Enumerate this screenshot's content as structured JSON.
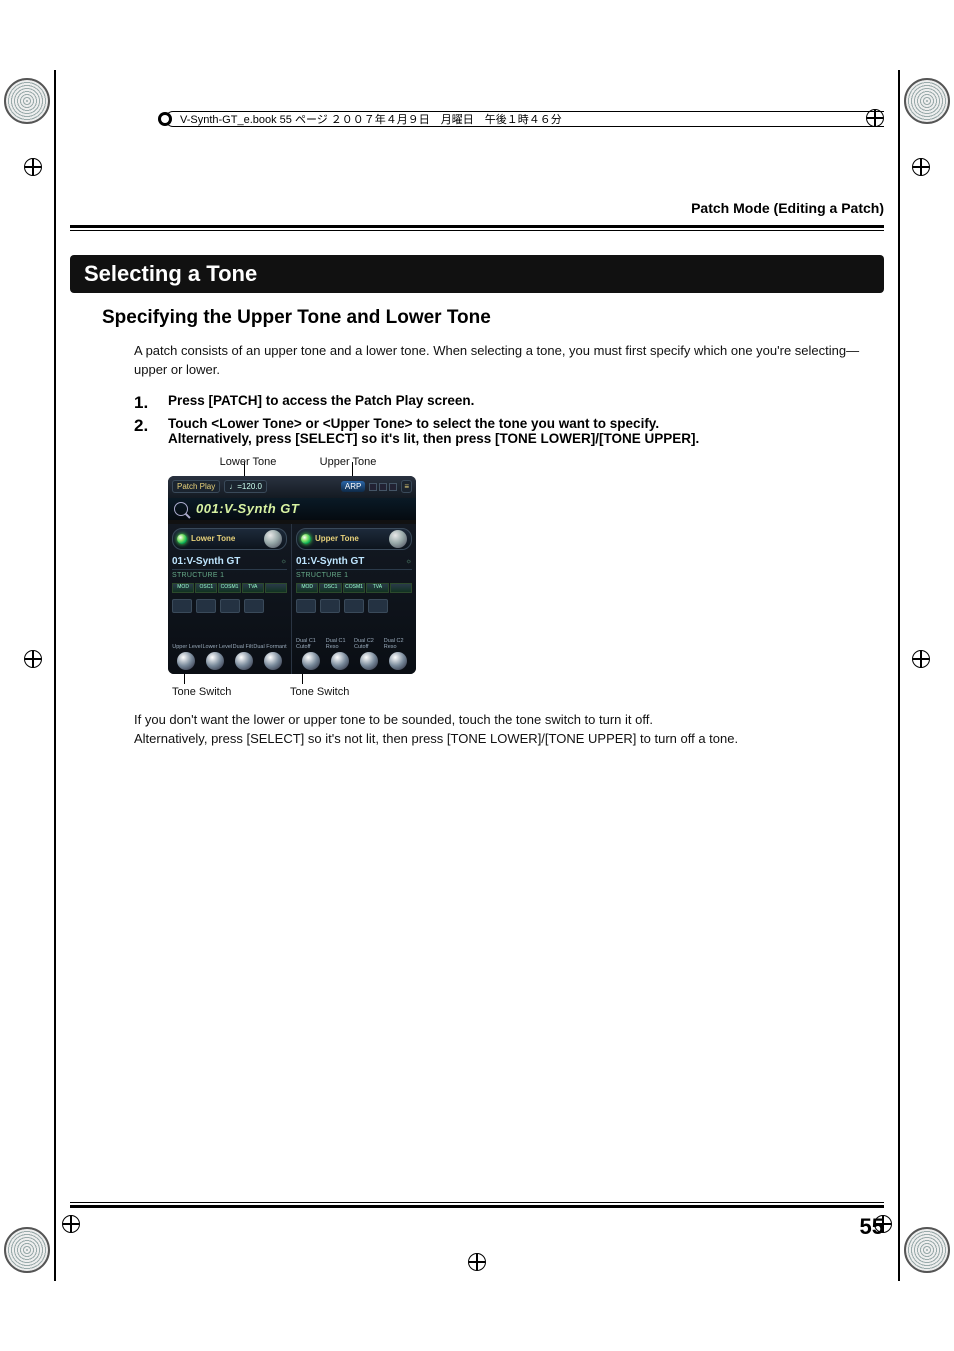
{
  "print": {
    "header_text": "V-Synth-GT_e.book 55 ページ ２００７年４月９日　月曜日　午後１時４６分"
  },
  "chapter_title": "Patch Mode (Editing a Patch)",
  "section_heading": "Selecting a Tone",
  "subsection_heading": "Specifying the Upper Tone and Lower Tone",
  "intro_paragraph": "A patch consists of an upper tone and a lower tone. When selecting a tone, you must first specify which one you're selecting—upper or lower.",
  "steps": [
    "Press [PATCH] to access the Patch Play screen.",
    "Touch <Lower Tone> or <Upper Tone> to select the tone you want to specify.\nAlternatively, press [SELECT] so it's lit, then press [TONE LOWER]/[TONE UPPER]."
  ],
  "figure": {
    "top_labels": {
      "lower": "Lower Tone",
      "upper": "Upper Tone"
    },
    "bottom_labels": {
      "left": "Tone Switch",
      "right": "Tone Switch"
    },
    "screen": {
      "nav_label": "Patch Play",
      "tempo": "120.0",
      "arp": "ARP",
      "title_line": "001:V-Synth GT",
      "lower_tab": "Lower Tone",
      "upper_tab": "Upper Tone",
      "panel_name": "01:V-Synth GT",
      "structure": "STRUCTURE 1",
      "sig": [
        "MOD",
        "OSC1",
        "COSM1",
        "TVA"
      ],
      "knob_labels_left": [
        "Upper Level",
        "Lower Level",
        "Dual Filt",
        "Dual Formant"
      ],
      "knob_labels_right": [
        "Dual C1 Cutoff",
        "Dual C1 Reso",
        "Dual C2 Cutoff",
        "Dual C2 Reso"
      ]
    }
  },
  "after_figure_paragraph": "If you don't want the lower or upper tone to be sounded, touch the tone switch to turn it off.\nAlternatively, press [SELECT] so it's not lit, then press [TONE LOWER]/[TONE UPPER] to turn off a tone.",
  "page_number": "55"
}
